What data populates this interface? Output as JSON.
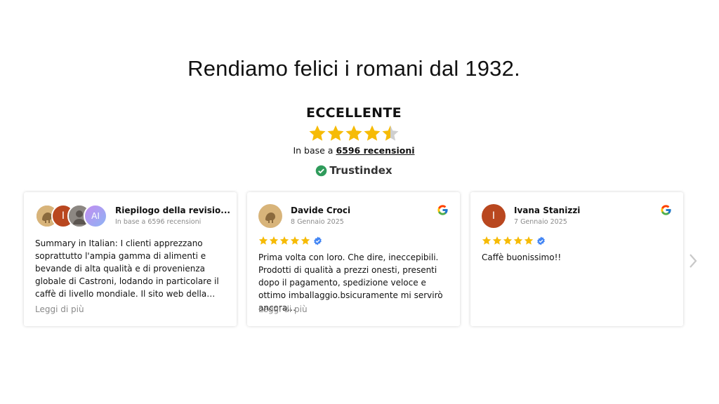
{
  "headline": "Rendiamo felici i romani dal 1932.",
  "summary": {
    "rating_word": "ECCELLENTE",
    "star_rating": 4.7,
    "based_on_prefix": "In base a",
    "based_on_link": "6596 recensioni",
    "brand": "Trustindex"
  },
  "colors": {
    "star": "#f6bb06",
    "star_empty": "#cfcfcf",
    "brand_green": "#2f9b5b",
    "verified": "#4285f4"
  },
  "cards": [
    {
      "title": "Riepilogo della revisio...",
      "subtitle": "In base a 6596 recensioni",
      "avatar_letters": [
        "I",
        "AI"
      ],
      "text": "Summary in Italian: I clienti apprezzano soprattutto l'ampia gamma di alimenti e bevande di alta qualità e di provenienza globale di Castroni, lodando in particolare il caffè di livello mondiale. Il sito web della…",
      "more": "Leggi di più"
    },
    {
      "name": "Davide Croci",
      "date": "8 Gennaio 2025",
      "rating": 5,
      "source_icon": "google-icon",
      "text": "Prima volta con loro. Che dire, ineccepibili. Prodotti di qualità a prezzi onesti, presenti dopo il pagamento, spedizione veloce e ottimo imballaggio.bsicuramente mi servirò ancora…",
      "more": "Leggi di più"
    },
    {
      "name": "Ivana Stanizzi",
      "date": "7 Gennaio 2025",
      "initial": "I",
      "rating": 5,
      "source_icon": "google-icon",
      "text": "Caffè buonissimo!!"
    }
  ]
}
